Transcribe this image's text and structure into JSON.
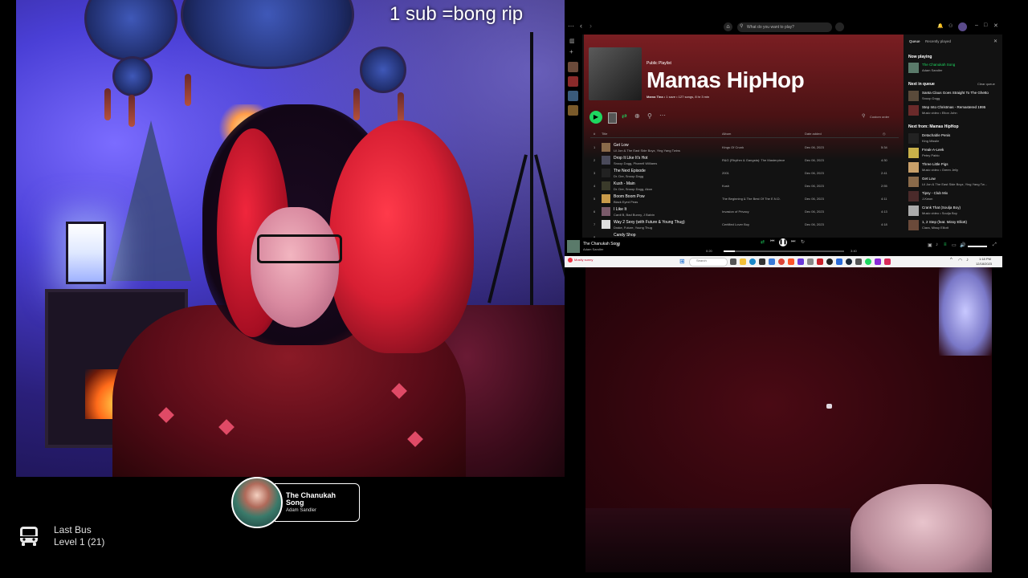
{
  "overlay": {
    "caption": "1 sub =bong rip"
  },
  "spotify": {
    "search_placeholder": "What do you want to play?",
    "playlist": {
      "type": "Public Playlist",
      "title": "Mamas HipHop",
      "owner": "Mama Tina",
      "meta": "• 1 save • 127 songs, 8 hr 3 min"
    },
    "sort_label": "Custom order",
    "columns": {
      "num": "#",
      "title": "Title",
      "album": "Album",
      "date": "Date added"
    },
    "tracks": [
      {
        "num": "1",
        "title": "Get Low",
        "artist": "Lil Jon & The East Side Boyz, Ying Yang Twins",
        "album": "Kings Of Crunk",
        "date": "Dec 06, 2023",
        "duration": "5:34"
      },
      {
        "num": "2",
        "title": "Drop It Like It's Hot",
        "artist": "Snoop Dogg, Pharrell Williams",
        "album": "R&G (Rhythm & Gangsta): The Masterpiece",
        "date": "Dec 06, 2023",
        "duration": "4:30"
      },
      {
        "num": "3",
        "title": "The Next Episode",
        "artist": "Dr. Dre, Snoop Dogg",
        "album": "2001",
        "date": "Dec 06, 2023",
        "duration": "2:41"
      },
      {
        "num": "4",
        "title": "Kush - Main",
        "artist": "Dr. Dre, Snoop Dogg, Akon",
        "album": "Kush",
        "date": "Dec 06, 2023",
        "duration": "2:55"
      },
      {
        "num": "5",
        "title": "Boom Boom Pow",
        "artist": "Black Eyed Peas",
        "album": "The Beginning & The Best Of The E.N.D.",
        "date": "Dec 06, 2023",
        "duration": "4:11"
      },
      {
        "num": "6",
        "title": "I Like It",
        "artist": "Cardi B, Bad Bunny, J Balvin",
        "album": "Invasion of Privacy",
        "date": "Dec 06, 2023",
        "duration": "4:13"
      },
      {
        "num": "7",
        "title": "Way 2 Sexy (with Future & Young Thug)",
        "artist": "Drake, Future, Young Thug",
        "album": "Certified Lover Boy",
        "date": "Dec 06, 2023",
        "duration": "4:18"
      },
      {
        "num": "8",
        "title": "Candy Shop",
        "artist": "",
        "album": "",
        "date": "",
        "duration": ""
      }
    ],
    "queue": {
      "tab_queue": "Queue",
      "tab_recent": "Recently played",
      "now_playing_label": "Now playing",
      "now_playing": {
        "title": "The Chanukah Song",
        "artist": "Adam Sandler"
      },
      "next_in_queue_label": "Next in queue",
      "clear_label": "Clear queue",
      "next_in_queue": [
        {
          "title": "Santa Claus Goes Straight To The Ghetto",
          "artist": "Snoop Dogg"
        },
        {
          "title": "Step Into Christmas - Remastered 1995",
          "artist": "Music video • Elton John"
        }
      ],
      "next_from_label": "Next from: Mamas HipHop",
      "next_from": [
        {
          "title": "Detachable Penis",
          "artist": "King Missile"
        },
        {
          "title": "Freak-A-Leek",
          "artist": "Petey Pablo"
        },
        {
          "title": "Three Little Pigs",
          "artist": "Music video • Green Jelly"
        },
        {
          "title": "Get Low",
          "artist": "Lil Jon & The East Side Boyz, Ying Yang Tw..."
        },
        {
          "title": "Tipsy - Club Mix",
          "artist": "J-Kwon"
        },
        {
          "title": "Crank That (Soulja Boy)",
          "artist": "Music video • Soulja Boy"
        },
        {
          "title": "1, 2 Step (feat. Missy Elliott)",
          "artist": "Ciara, Missy Elliott"
        }
      ]
    },
    "player": {
      "title": "The Chanukah Song",
      "artist": "Adam Sandler",
      "elapsed": "0:20",
      "total": "3:40",
      "progress": 0.09
    }
  },
  "taskbar": {
    "weather": "Mostly sunny",
    "search_placeholder": "Search",
    "clock_time": "1:18 PM",
    "clock_date": "12/18/2023"
  },
  "now_playing_widget": {
    "title": "The Chanukah Song",
    "artist": "Adam Sandler"
  },
  "last_bus": {
    "name": "Last Bus",
    "level": "Level 1  (21)"
  },
  "colors": {
    "spotify_green": "#1ed760",
    "playlist_red": "#7a1e22"
  }
}
